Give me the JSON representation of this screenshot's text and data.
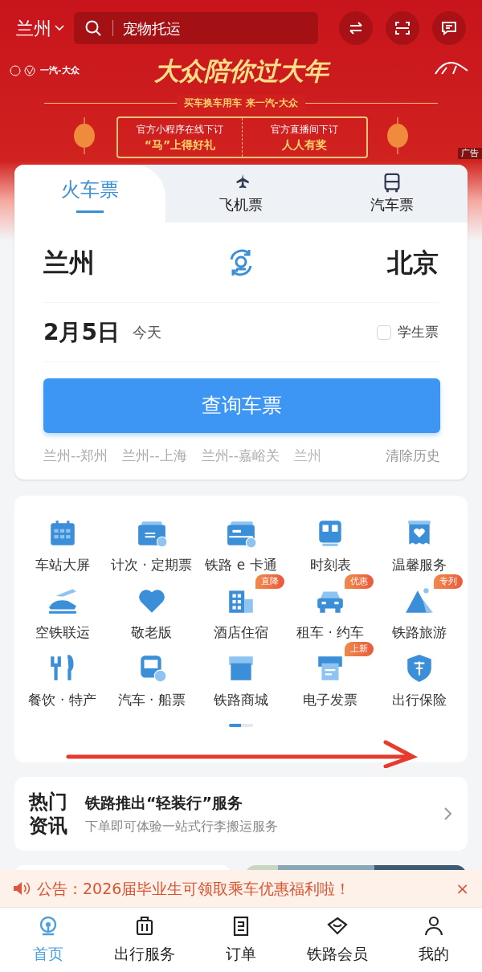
{
  "top_bar": {
    "city": "兰州",
    "search_placeholder": "宠物托运"
  },
  "banner": {
    "brand": "一汽-大众",
    "headline": "大众陪你过大年",
    "subline": "买车换车用车 来一汽-大众",
    "offers": [
      {
        "line1": "官方小程序在线下订",
        "line2": "“马”上得好礼"
      },
      {
        "line1": "官方直播间下订",
        "line2": "人人有奖"
      }
    ],
    "ad_label": "广告"
  },
  "ticket_tabs": [
    {
      "label": "火车票",
      "selected": true
    },
    {
      "label": "飞机票",
      "selected": false
    },
    {
      "label": "汽车票",
      "selected": false
    }
  ],
  "route": {
    "from": "兰州",
    "to": "北京"
  },
  "date": {
    "value": "2月5日",
    "note": "今天"
  },
  "student_ticket": {
    "label": "学生票",
    "checked": false
  },
  "search_button": "查询车票",
  "history": [
    "兰州--郑州",
    "兰州--上海",
    "兰州--嘉峪关",
    "兰州"
  ],
  "clear_history": "清除历史",
  "services": [
    {
      "label": "车站大屏"
    },
    {
      "label": "计次 · 定期票"
    },
    {
      "label": "铁路 e 卡通"
    },
    {
      "label": "时刻表"
    },
    {
      "label": "温馨服务"
    },
    {
      "label": "空铁联运"
    },
    {
      "label": "敬老版"
    },
    {
      "label": "酒店住宿",
      "badge": "直降"
    },
    {
      "label": "租车 · 约车",
      "badge": "优惠"
    },
    {
      "label": "铁路旅游",
      "badge": "专列"
    },
    {
      "label": "餐饮 · 特产"
    },
    {
      "label": "汽车 · 船票"
    },
    {
      "label": "铁路商城"
    },
    {
      "label": "电子发票",
      "badge": "上新"
    },
    {
      "label": "出行保险"
    }
  ],
  "pager": [
    {
      "selected": true
    },
    {
      "selected": false
    }
  ],
  "news": {
    "tag_line1": "热门",
    "tag_line2": "资讯",
    "title": "铁路推出“轻装行”服务",
    "subtitle": "下单即可体验一站式行李搬运服务"
  },
  "notice": {
    "text": "公告：2026届毕业生可领取乘车优惠福利啦！",
    "close": "×"
  },
  "bottom_nav": [
    {
      "label": "首页",
      "selected": true
    },
    {
      "label": "出行服务",
      "selected": false
    },
    {
      "label": "订单",
      "selected": false
    },
    {
      "label": "铁路会员",
      "selected": false
    },
    {
      "label": "我的",
      "selected": false
    }
  ]
}
